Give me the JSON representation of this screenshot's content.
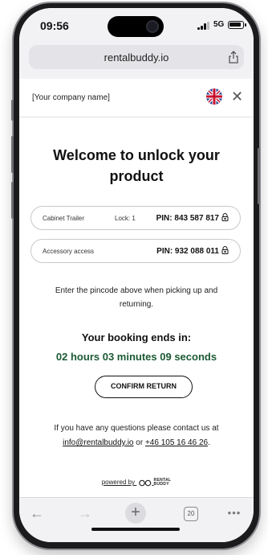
{
  "status_bar": {
    "time": "09:56",
    "network": "5G"
  },
  "browser": {
    "url": "rentalbuddy.io",
    "tab_count": "20"
  },
  "header": {
    "company": "[Your company name]"
  },
  "main": {
    "title": "Welcome to unlock your product",
    "pins": [
      {
        "name": "Cabinet Trailer",
        "lock": "Lock: 1",
        "pin": "PIN: 843 587 817"
      },
      {
        "name": "Accessory access",
        "lock": "",
        "pin": "PIN: 932 088 011"
      }
    ],
    "instruction": "Enter the pincode above when picking up and returning.",
    "booking_ends_label": "Your booking ends in:",
    "countdown": "02 hours 03 minutes 09 seconds",
    "confirm_button": "CONFIRM RETURN",
    "contact_prefix": "If you have any questions please contact us at",
    "contact_email": "info@rentalbuddy.io",
    "contact_or": "or",
    "contact_phone": "+46 105 16 46 26",
    "contact_suffix": ".",
    "powered_by": "powered by",
    "brand_line1": "RENTAL",
    "brand_line2": "BUDDY"
  },
  "colors": {
    "countdown": "#1c5a34",
    "browser_chrome": "#f2f2f4"
  },
  "icons": [
    "share-icon",
    "flag-uk-icon",
    "close-icon",
    "padlock-icon",
    "back-arrow-icon",
    "forward-arrow-icon",
    "plus-icon",
    "tabs-icon",
    "more-icon"
  ]
}
